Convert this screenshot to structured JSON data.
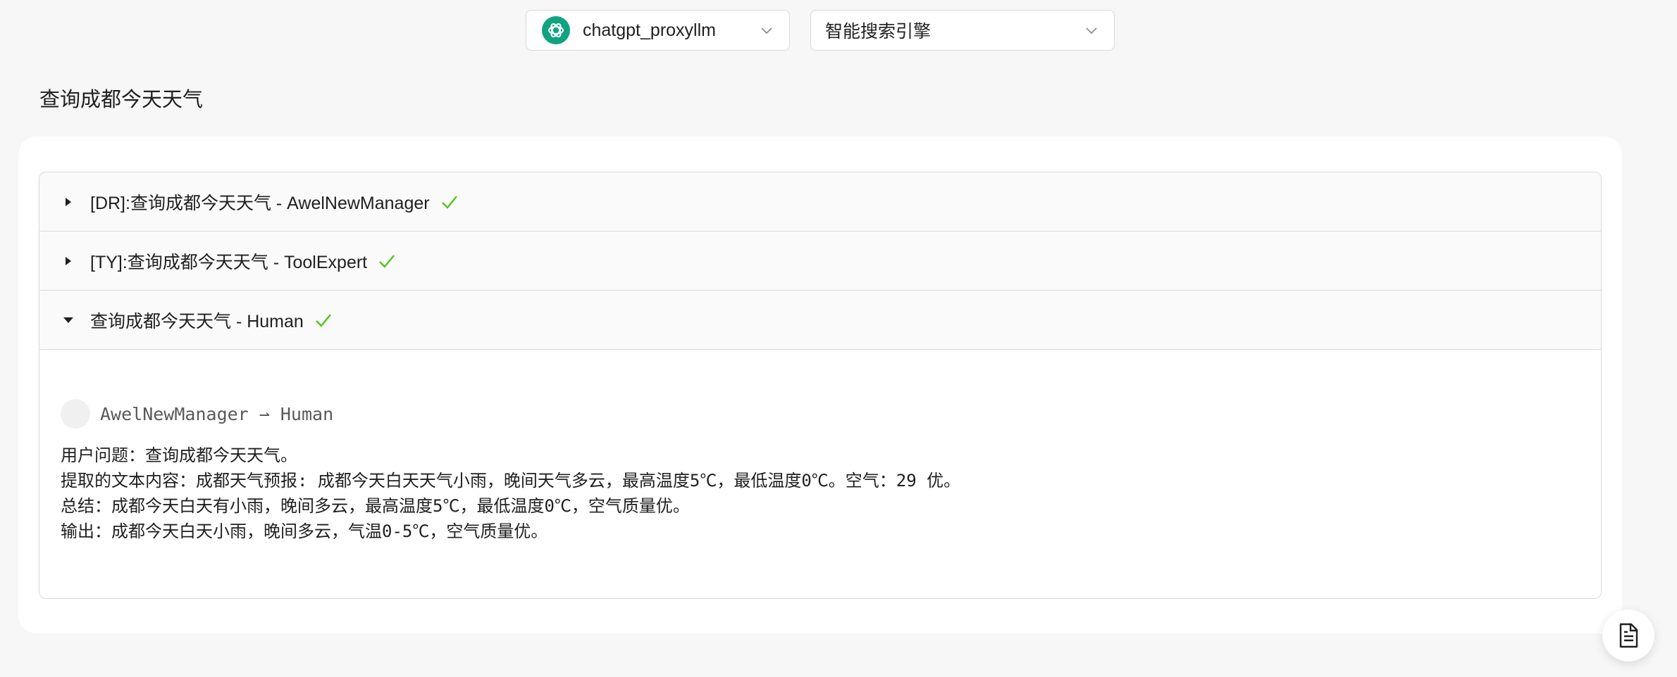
{
  "header": {
    "model_select": {
      "value": "chatgpt_proxyllm",
      "icon": "openai-logo"
    },
    "mode_select": {
      "value": "智能搜索引擎"
    }
  },
  "query_title": "查询成都今天天气",
  "panels": [
    {
      "title": "[DR]:查询成都今天天气 - AwelNewManager",
      "expanded": false,
      "status": "success"
    },
    {
      "title": "[TY]:查询成都今天天气 - ToolExpert",
      "expanded": false,
      "status": "success"
    },
    {
      "title": "查询成都今天天气 - Human",
      "expanded": true,
      "status": "success",
      "message": {
        "from": "AwelNewManager ⇀ Human",
        "lines": [
          "用户问题：查询成都今天天气。",
          "提取的文本内容：成都天气预报: 成都今天白天天气小雨，晚间天气多云，最高温度5℃，最低温度0℃。空气：29 优。",
          "总结：成都今天白天有小雨，晚间多云，最高温度5℃，最低温度0℃，空气质量优。",
          "输出：成都今天白天小雨，晚间多云，气温0-5℃，空气质量优。"
        ]
      }
    }
  ],
  "colors": {
    "success": "#52c41a",
    "accent": "#10a37f"
  },
  "floating_button": {
    "icon": "file-text-icon"
  }
}
